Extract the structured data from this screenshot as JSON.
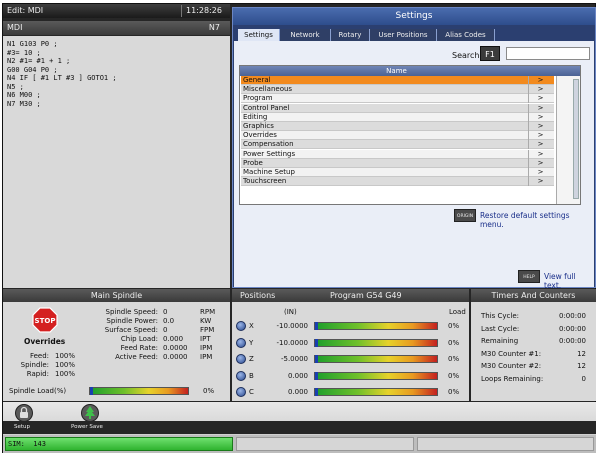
{
  "left_panel": {
    "title": "Edit: MDI",
    "time": "11:28:26",
    "mdi_label": "MDI",
    "block": "N7",
    "code_lines": [
      "N1 G103 P0 ;",
      "#3= 10 ;",
      "N2 #1= #1 + 1 ;",
      "G00 G04 P0 ;",
      "N4 IF [ #1 LT #3 ] GOTO1 ;",
      "N5 ;",
      "N6 M00 ;",
      "N7 M30 ;"
    ]
  },
  "settings": {
    "title": "Settings",
    "tabs": [
      "Settings",
      "Network",
      "Rotary",
      "User Positions",
      "Alias Codes"
    ],
    "active_tab": "Settings",
    "search_label": "Search",
    "search_key": "F1",
    "search_value": "",
    "column_name": "Name",
    "rows": [
      {
        "name": "General",
        "arrow": ">"
      },
      {
        "name": "Miscellaneous",
        "arrow": ">"
      },
      {
        "name": "Program",
        "arrow": ">"
      },
      {
        "name": "Control Panel",
        "arrow": ">"
      },
      {
        "name": "Editing",
        "arrow": ">"
      },
      {
        "name": "Graphics",
        "arrow": ">"
      },
      {
        "name": "Overrides",
        "arrow": ">"
      },
      {
        "name": "Compensation",
        "arrow": ">"
      },
      {
        "name": "Power Settings",
        "arrow": ">"
      },
      {
        "name": "Probe",
        "arrow": ">"
      },
      {
        "name": "Machine Setup",
        "arrow": ">"
      },
      {
        "name": "Touchscreen",
        "arrow": ">"
      }
    ],
    "selected_row": "General",
    "origin_key": "ORIGIN",
    "restore_label": "Restore default settings menu.",
    "help_key": "HELP",
    "view_full_text": "View full text."
  },
  "main_spindle": {
    "title": "Main Spindle",
    "stop_label": "STOP",
    "overrides_label": "Overrides",
    "overrides": [
      {
        "label": "Feed:",
        "value": "100%"
      },
      {
        "label": "Spindle:",
        "value": "100%"
      },
      {
        "label": "Rapid:",
        "value": "100%"
      }
    ],
    "stats": [
      {
        "label": "Spindle Speed:",
        "value": "0",
        "unit": "RPM"
      },
      {
        "label": "Spindle Power:",
        "value": "0.0",
        "unit": "KW"
      },
      {
        "label": "Surface Speed:",
        "value": "0",
        "unit": "FPM"
      },
      {
        "label": "Chip Load:",
        "value": "0.000",
        "unit": "IPT"
      },
      {
        "label": "Feed Rate:",
        "value": "0.0000",
        "unit": "IPM"
      },
      {
        "label": "Active Feed:",
        "value": "0.0000",
        "unit": "IPM"
      }
    ],
    "load_label": "Spindle Load(%)",
    "load_value": "0%",
    "load_fraction": 0
  },
  "positions": {
    "title": "Positions",
    "program_label": "Program G54 G49",
    "unit_label": "(IN)",
    "load_header": "Load",
    "axes": [
      {
        "axis": "X",
        "value": "-10.0000",
        "load": "0%",
        "fraction": 0
      },
      {
        "axis": "Y",
        "value": "-10.0000",
        "load": "0%",
        "fraction": 0
      },
      {
        "axis": "Z",
        "value": "-5.0000",
        "load": "0%",
        "fraction": 0
      },
      {
        "axis": "B",
        "value": "0.000",
        "load": "0%",
        "fraction": 0
      },
      {
        "axis": "C",
        "value": "0.000",
        "load": "0%",
        "fraction": 0
      }
    ]
  },
  "timers": {
    "title": "Timers And Counters",
    "rows": [
      {
        "label": "This Cycle:",
        "value": "0:00:00"
      },
      {
        "label": "Last Cycle:",
        "value": "0:00:00"
      },
      {
        "label": "Remaining",
        "value": "0:00:00"
      },
      {
        "label": "M30 Counter #1:",
        "value": "12"
      },
      {
        "label": "M30 Counter #2:",
        "value": "12"
      },
      {
        "label": "Loops Remaining:",
        "value": "0"
      }
    ]
  },
  "toolbar": {
    "setup_label": "Setup",
    "power_save_label": "Power Save"
  },
  "status": {
    "text": "SIM:  143"
  },
  "colors": {
    "highlight": "#f28a1e",
    "accent": "#3b5ca0",
    "status_green": "#3cc43c"
  }
}
